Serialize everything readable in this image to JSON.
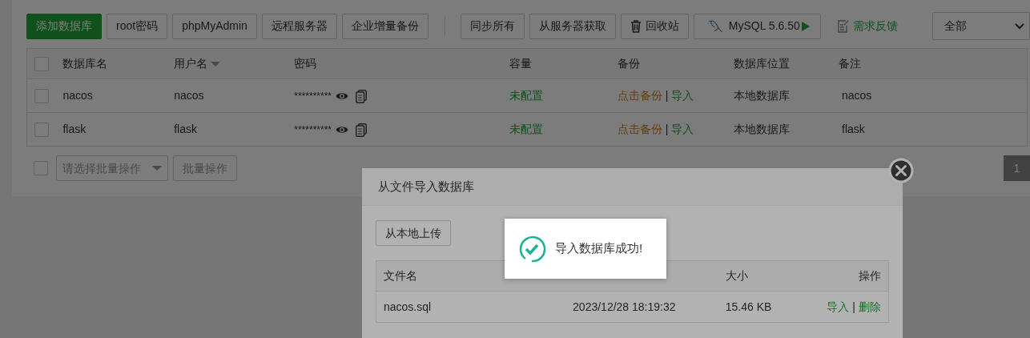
{
  "toolbar": {
    "left_buttons": [
      {
        "label": "添加数据库",
        "kind": "primary"
      },
      {
        "label": "root密码",
        "kind": "default"
      },
      {
        "label": "phpMyAdmin",
        "kind": "default"
      },
      {
        "label": "远程服务器",
        "kind": "default"
      },
      {
        "label": "企业增量备份",
        "kind": "default"
      }
    ],
    "right_buttons": [
      {
        "label": "同步所有",
        "kind": "default"
      },
      {
        "label": "从服务器获取",
        "kind": "default"
      },
      {
        "label": "回收站",
        "kind": "trash"
      },
      {
        "label": "MySQL 5.6.50",
        "kind": "mysql"
      }
    ],
    "feedback": "需求反馈",
    "filter": {
      "value": "全部"
    }
  },
  "table": {
    "header_checked": false,
    "columns": [
      {
        "label": "数据库名",
        "sortable": false
      },
      {
        "label": "用户名",
        "sortable": true
      },
      {
        "label": "密码",
        "sortable": false
      },
      {
        "label": "容量",
        "sortable": false
      },
      {
        "label": "备份",
        "sortable": false
      },
      {
        "label": "数据库位置",
        "sortable": false
      },
      {
        "label": "备注",
        "sortable": false
      }
    ],
    "rows": [
      {
        "checked": false,
        "name": "nacos",
        "user": "nacos",
        "password": "**********",
        "capacity": "未配置",
        "backup": "点击备份",
        "separator": "|",
        "import": "导入",
        "location": "本地数据库",
        "note": "nacos"
      },
      {
        "checked": false,
        "name": "flask",
        "user": "flask",
        "password": "**********",
        "capacity": "未配置",
        "backup": "点击备份",
        "separator": "|",
        "import": "导入",
        "location": "本地数据库",
        "note": "flask"
      }
    ]
  },
  "batch": {
    "checked": false,
    "placeholder": "请选择批量操作",
    "button": "批量操作"
  },
  "pagination": [
    {
      "label": "1",
      "selected": true
    }
  ],
  "modal": {
    "title": "从文件导入数据库",
    "upload_button": "从本地上传",
    "columns": [
      "文件名",
      "大小",
      "操作"
    ],
    "files": [
      {
        "name": "nacos.sql",
        "time": "2023/12/28 18:19:32",
        "size": "15.46 KB",
        "actions": [
          "导入",
          "删除"
        ],
        "separator": "|"
      }
    ]
  },
  "toast": {
    "message": "导入数据库成功!"
  }
}
